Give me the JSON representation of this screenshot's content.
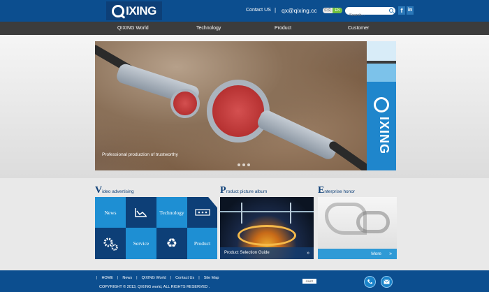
{
  "header": {
    "logo_text": "IXING",
    "contact_label": "Contact US",
    "separator": "|",
    "email": "qx@qixing.cc",
    "lang_cn": "中文",
    "lang_en": "EN",
    "search_placeholder": "Search..."
  },
  "nav": {
    "items": [
      "QIXING World",
      "Technology",
      "Product",
      "Customer"
    ]
  },
  "banner": {
    "caption": "Professional production of trustworthy",
    "side_logo_text": "IXING"
  },
  "sections": {
    "video": {
      "initial": "V",
      "title": "ideo advertising"
    },
    "product": {
      "initial": "P",
      "title": "roduct picture album"
    },
    "enterprise": {
      "initial": "E",
      "title": "nterprise honor"
    }
  },
  "tiles": {
    "news": "News",
    "technology": "Technology",
    "service": "Service",
    "product": "Product"
  },
  "product_album": {
    "label": "Product Selection Guide",
    "arrow": "»"
  },
  "enterprise": {
    "more": "More",
    "arrow": "»"
  },
  "footer": {
    "links": [
      "HOME",
      "News",
      "QIXING World",
      "Contact Us",
      "Site Map"
    ],
    "copyright": "COPYRIGHT © 2013, QIXING world, ALL RIGHTS RESERVED .",
    "badge": "CNZZ"
  },
  "colors": {
    "brand_blue": "#0c4e8f",
    "tile_dark": "#0d3f77",
    "tile_light": "#1e8fd3",
    "nav_bg": "#3c3c3c"
  }
}
